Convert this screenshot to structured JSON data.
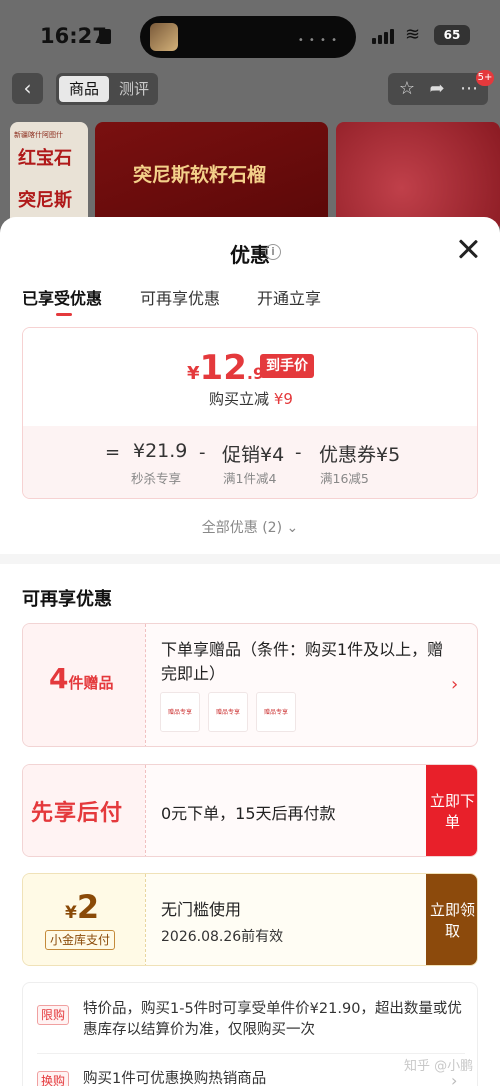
{
  "status_bar": {
    "time": "16:27",
    "battery": "65"
  },
  "nav": {
    "tabs": [
      "商品",
      "测评"
    ],
    "cart_badge": "5+"
  },
  "thumbnails": {
    "t1_small": "新疆喀什阿图什",
    "t1_line1": "红宝石",
    "t1_line2": "突尼斯",
    "t2_text": "突尼斯软籽石榴"
  },
  "sheet": {
    "title": "优惠",
    "tabs": [
      "已享受优惠",
      "可再享优惠",
      "开通立享"
    ]
  },
  "price": {
    "symbol": "¥",
    "integer": "12",
    "decimal": ".9",
    "final_tag": "到手价",
    "instant_label": "购买立减",
    "instant_amount": "¥9",
    "calc": {
      "eq": "=",
      "minus": "-",
      "base_value": "¥21.9",
      "base_sub": "秒杀专享",
      "promo_value": "促销¥4",
      "promo_sub": "满1件减4",
      "coupon_value": "优惠券¥5",
      "coupon_sub": "满16减5"
    }
  },
  "all_deals": "全部优惠 (2)",
  "section_title": "可再享优惠",
  "gift": {
    "count": "4",
    "unit": "件赠品",
    "text": "下单享赠品（条件：购买1件及以上，赠完即止）",
    "thumb_label": "赠品专享"
  },
  "paylater": {
    "title": "先享后付",
    "text": "0元下单，15天后再付款",
    "button": "立即下单"
  },
  "coupon": {
    "symbol": "¥",
    "amount": "2",
    "tag": "小金库支付",
    "text1": "无门槛使用",
    "text2": "2026.08.26前有效",
    "button": "立即领取"
  },
  "rules": [
    {
      "tag": "限购",
      "text": "特价品，购买1-5件时可享受单件价¥21.90，超出数量或优惠库存以结算价为准，仅限购买一次"
    },
    {
      "tag": "换购",
      "text": "购买1件可优惠换购热销商品"
    }
  ],
  "watermark": "知乎 @小鹏"
}
